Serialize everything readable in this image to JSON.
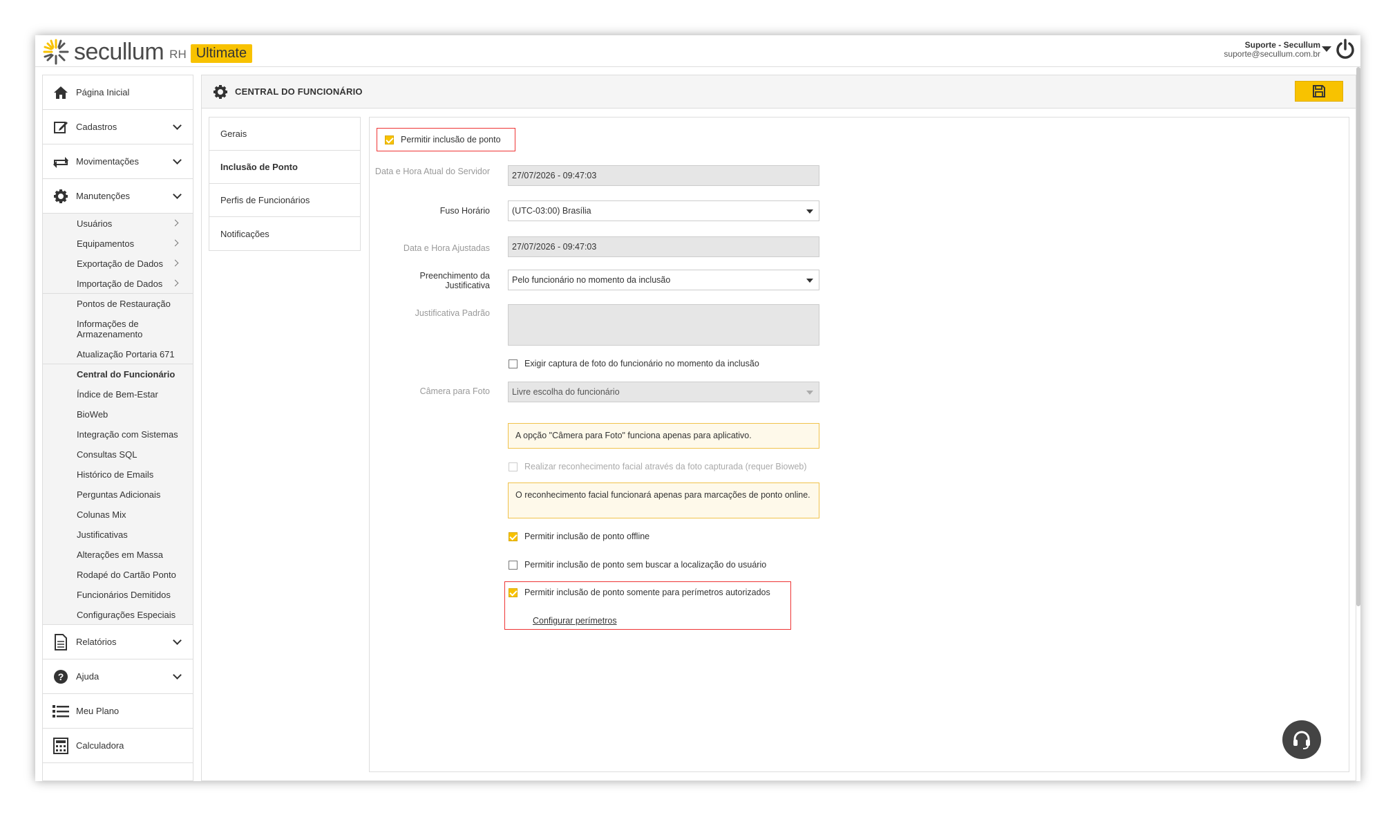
{
  "header": {
    "logo_text": "secullum",
    "logo_rh": "RH",
    "logo_badge": "Ultimate",
    "user_name": "Suporte - Secullum",
    "user_email": "suporte@secullum.com.br"
  },
  "sidebar": {
    "main_items": [
      {
        "label": "Página Inicial",
        "icon": "home-icon"
      },
      {
        "label": "Cadastros",
        "icon": "edit-icon"
      },
      {
        "label": "Movimentações",
        "icon": "swap-icon"
      },
      {
        "label": "Manutenções",
        "icon": "gear-icon"
      }
    ],
    "sub_items": [
      {
        "label": "Usuários"
      },
      {
        "label": "Equipamentos"
      },
      {
        "label": "Exportação de Dados"
      },
      {
        "label": "Importação de Dados"
      },
      {
        "label": "Pontos de Restauração"
      },
      {
        "label": "Informações de Armazenamento"
      },
      {
        "label": "Atualização Portaria 671"
      },
      {
        "label": "Central do Funcionário"
      },
      {
        "label": "Índice de Bem-Estar"
      },
      {
        "label": "BioWeb"
      },
      {
        "label": "Integração com Sistemas"
      },
      {
        "label": "Consultas SQL"
      },
      {
        "label": "Histórico de Emails"
      },
      {
        "label": "Perguntas Adicionais"
      },
      {
        "label": "Colunas Mix"
      },
      {
        "label": "Justificativas"
      },
      {
        "label": "Alterações em Massa"
      },
      {
        "label": "Rodapé do Cartão Ponto"
      },
      {
        "label": "Funcionários Demitidos"
      },
      {
        "label": "Configurações Especiais"
      }
    ],
    "bottom_items": [
      {
        "label": "Relatórios",
        "icon": "document-icon"
      },
      {
        "label": "Ajuda",
        "icon": "help-icon"
      },
      {
        "label": "Meu Plano",
        "icon": "list-icon"
      },
      {
        "label": "Calculadora",
        "icon": "calculator-icon"
      }
    ]
  },
  "main": {
    "title": "CENTRAL DO FUNCIONÁRIO",
    "tabs": [
      {
        "label": "Gerais"
      },
      {
        "label": "Inclusão de Ponto"
      },
      {
        "label": "Perfis de Funcionários"
      },
      {
        "label": "Notificações"
      }
    ],
    "form": {
      "permitir_inclusao": "Permitir inclusão de ponto",
      "data_hora_servidor_label": "Data e Hora Atual do Servidor",
      "data_hora_servidor_value": "27/07/2026 - 09:47:03",
      "fuso_label": "Fuso Horário",
      "fuso_value": "(UTC-03:00) Brasília",
      "data_hora_ajustadas_label": "Data e Hora Ajustadas",
      "data_hora_ajustadas_value": "27/07/2026 - 09:47:03",
      "preenchimento_label": "Preenchimento da Justificativa",
      "preenchimento_value": "Pelo funcionário no momento da inclusão",
      "justificativa_padrao_label": "Justificativa Padrão",
      "exigir_foto": "Exigir captura de foto do funcionário no momento da inclusão",
      "camera_label": "Câmera para Foto",
      "camera_value": "Livre escolha do funcionário",
      "camera_warning": "A opção \"Câmera para Foto\" funciona apenas para aplicativo.",
      "reconhecimento_facial": "Realizar reconhecimento facial através da foto capturada (requer Bioweb)",
      "facial_warning": "O reconhecimento facial funcionará apenas para marcações de ponto online.",
      "offline": "Permitir inclusão de ponto offline",
      "sem_localizacao": "Permitir inclusão de ponto sem buscar a localização do usuário",
      "perimetros": "Permitir inclusão de ponto somente para perímetros autorizados",
      "configurar_perimetros": "Configurar perímetros"
    }
  }
}
